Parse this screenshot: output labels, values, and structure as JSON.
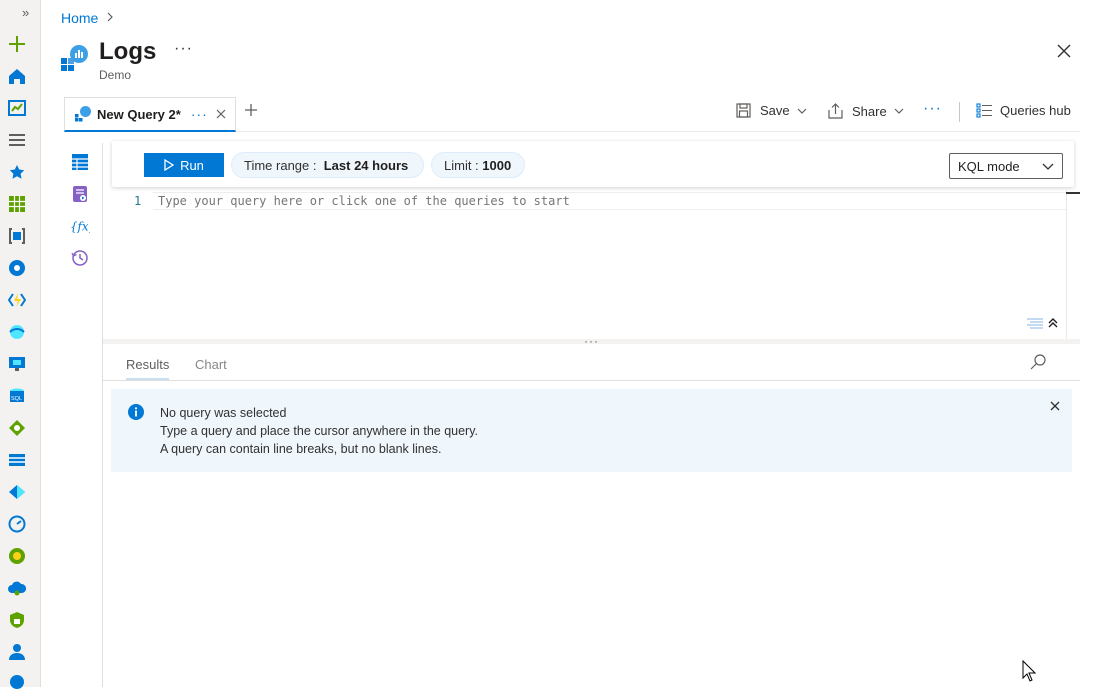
{
  "breadcrumb": {
    "home": "Home"
  },
  "header": {
    "title": "Logs",
    "subtitle": "Demo",
    "more": "···"
  },
  "tabs": [
    {
      "label": "New Query 2*",
      "more": "···"
    }
  ],
  "commands": {
    "save": "Save",
    "share": "Share",
    "more": "···",
    "queries_hub": "Queries hub"
  },
  "query_bar": {
    "run": "Run",
    "time_range_label": "Time range :",
    "time_range_value": "Last 24 hours",
    "limit_label": "Limit :",
    "limit_value": "1000",
    "mode": "KQL mode"
  },
  "editor": {
    "line_number": "1",
    "placeholder": "Type your query here or click one of the queries to start"
  },
  "results": {
    "tabs": [
      "Results",
      "Chart"
    ],
    "active_tab": "Results",
    "banner": {
      "title": "No query was selected",
      "line2": "Type a query and place the cursor anywhere in the query.",
      "line3": "A query can contain line breaks, but no blank lines."
    }
  },
  "rail_icons": [
    "expand-icon",
    "create-icon",
    "home-icon",
    "dashboard-icon",
    "all-services-icon",
    "favorites-icon",
    "all-resources-icon",
    "resource-groups-icon",
    "cosmos-icon",
    "function-app-icon",
    "network-icon",
    "virtual-machine-icon",
    "sql-icon",
    "load-balancer-icon",
    "storage-icon",
    "devops-icon",
    "monitor-icon",
    "cost-icon",
    "cloud-icon",
    "security-icon",
    "user-icon",
    "more-icon"
  ],
  "colors": {
    "accent": "#0078d4",
    "banner_bg": "#eff6fc",
    "rail_bg": "#f3f2f1"
  }
}
